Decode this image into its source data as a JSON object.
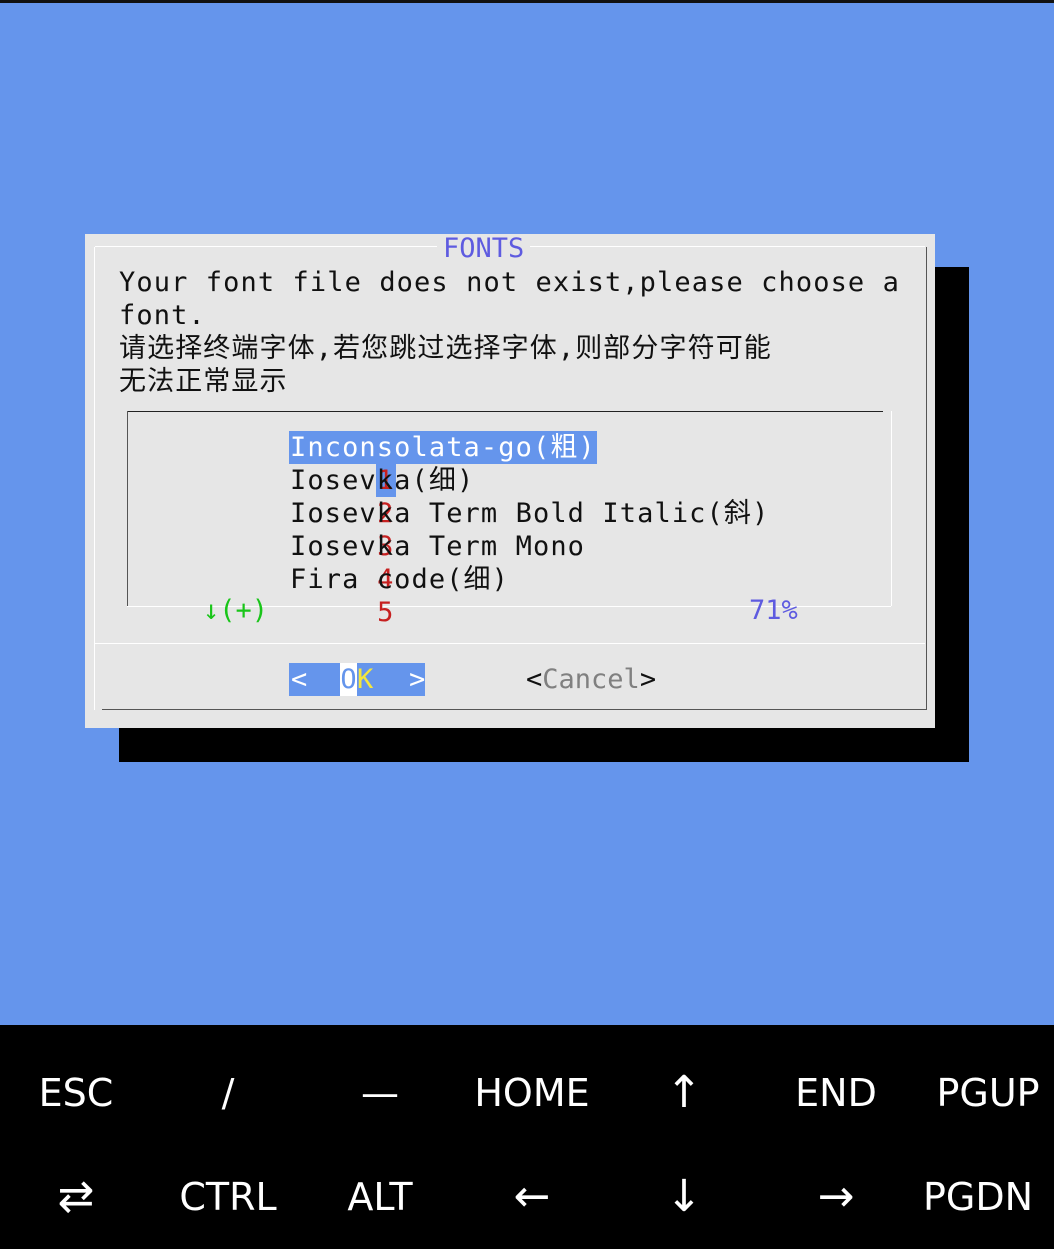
{
  "dialog": {
    "title": "FONTS",
    "message": "Your font file does not exist,please choose a\nfont.\n请选择终端字体,若您跳过选择字体,则部分字符可能\n无法正常显示",
    "items": [
      {
        "num": "1",
        "name": "Inconsolata-go(粗)"
      },
      {
        "num": "2",
        "name": "Iosevka(细)"
      },
      {
        "num": "3",
        "name": "Iosevka Term Bold Italic(斜)"
      },
      {
        "num": "4",
        "name": "Iosevka Term Mono"
      },
      {
        "num": "5",
        "name": "Fira code(细)"
      }
    ],
    "selected_index": 0,
    "scroll_more": "↓(+)",
    "scroll_percent": "71%",
    "ok_lt": "<",
    "ok_o": "O",
    "ok_k": "K",
    "ok_gt": ">",
    "cancel_lt": "<",
    "cancel_label": "Cancel",
    "cancel_gt": ">"
  },
  "keybar": {
    "row1": [
      "ESC",
      "/",
      "—",
      "HOME",
      "↑",
      "END",
      "PGUP"
    ],
    "row2": [
      "⇄",
      "CTRL",
      "ALT",
      "←",
      "↓",
      "→",
      "PGDN"
    ]
  },
  "colors": {
    "terminal_bg": "#6595EC",
    "dialog_bg": "#E6E6E6",
    "title": "#5E5BE0",
    "item_number": "#C62020",
    "scroll_indicator": "#19C519",
    "ok_hotkey": "#F5E63D"
  }
}
